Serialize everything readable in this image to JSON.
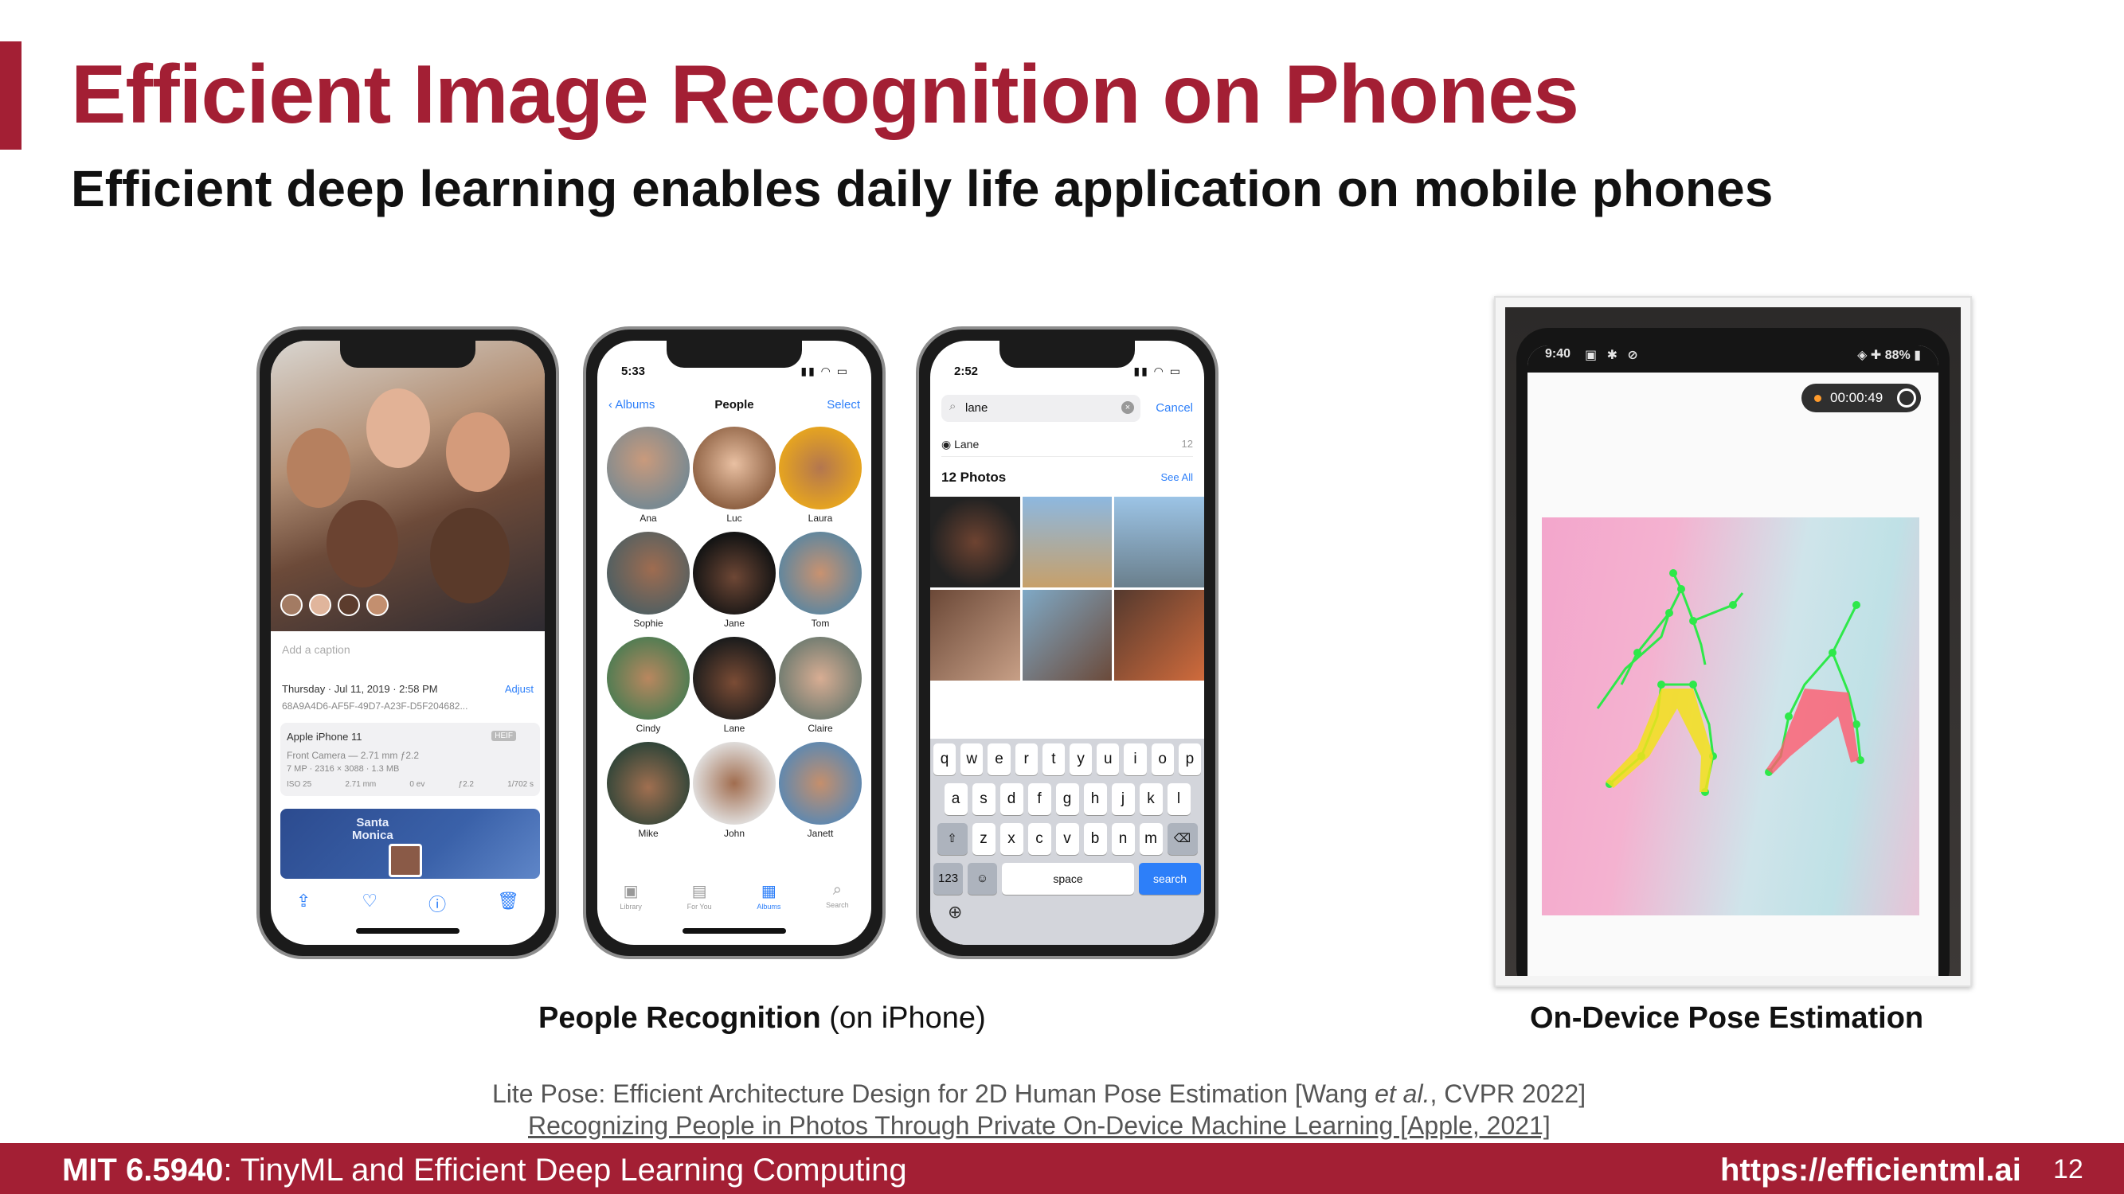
{
  "slide": {
    "title": "Efficient Image Recognition on Phones",
    "subtitle": "Efficient deep learning enables daily life application on mobile phones",
    "accent_color": "#a31f34"
  },
  "phone1": {
    "caption_placeholder": "Add a caption",
    "date": "Thursday · Jul 11, 2019 · 2:58 PM",
    "adjust": "Adjust",
    "file_id": "68A9A4D6-AF5F-49D7-A23F-D5F204682...",
    "camera_model": "Apple iPhone 11",
    "camera_badge": "HEIF",
    "lens": "Front Camera — 2.71 mm ƒ2.2",
    "resolution": "7 MP · 2316 × 3088 · 1.3 MB",
    "exif": [
      "ISO 25",
      "2.71 mm",
      "0 ev",
      "ƒ2.2",
      "1/702 s"
    ],
    "map_label": "Santa\nMonica"
  },
  "phone2": {
    "time": "5:33",
    "back": "Albums",
    "title": "People",
    "action": "Select",
    "people": [
      "Ana",
      "Luc",
      "Laura",
      "Sophie",
      "Jane",
      "Tom",
      "Cindy",
      "Lane",
      "Claire",
      "Mike",
      "John",
      "Janett"
    ],
    "tabs": [
      "Library",
      "For You",
      "Albums",
      "Search"
    ]
  },
  "phone3": {
    "time": "2:52",
    "query": "lane",
    "cancel": "Cancel",
    "suggestion": "Lane",
    "suggestion_count": "12",
    "section": "12 Photos",
    "see_all": "See All",
    "rows": [
      [
        "q",
        "w",
        "e",
        "r",
        "t",
        "y",
        "u",
        "i",
        "o",
        "p"
      ],
      [
        "a",
        "s",
        "d",
        "f",
        "g",
        "h",
        "j",
        "k",
        "l"
      ],
      [
        "z",
        "x",
        "c",
        "v",
        "b",
        "n",
        "m"
      ]
    ],
    "num_key": "123",
    "space": "space",
    "search": "search"
  },
  "pose": {
    "time": "9:40",
    "battery": "88%",
    "recording": "00:00:49"
  },
  "captions": {
    "left_bold": "People Recognition",
    "left_rest": " (on iPhone)",
    "right": "On-Device Pose Estimation"
  },
  "references": {
    "ref1_a": "Lite Pose: Efficient Architecture Design for 2D Human Pose Estimation [Wang ",
    "ref1_em": "et al.",
    "ref1_b": ", CVPR 2022]",
    "ref2": "Recognizing People in Photos Through Private On-Device Machine Learning [Apple, 2021]"
  },
  "footer": {
    "course_code": "MIT 6.5940",
    "course_name": ": TinyML and Efficient Deep Learning Computing",
    "url": "https://efficientml.ai",
    "page": "12"
  }
}
